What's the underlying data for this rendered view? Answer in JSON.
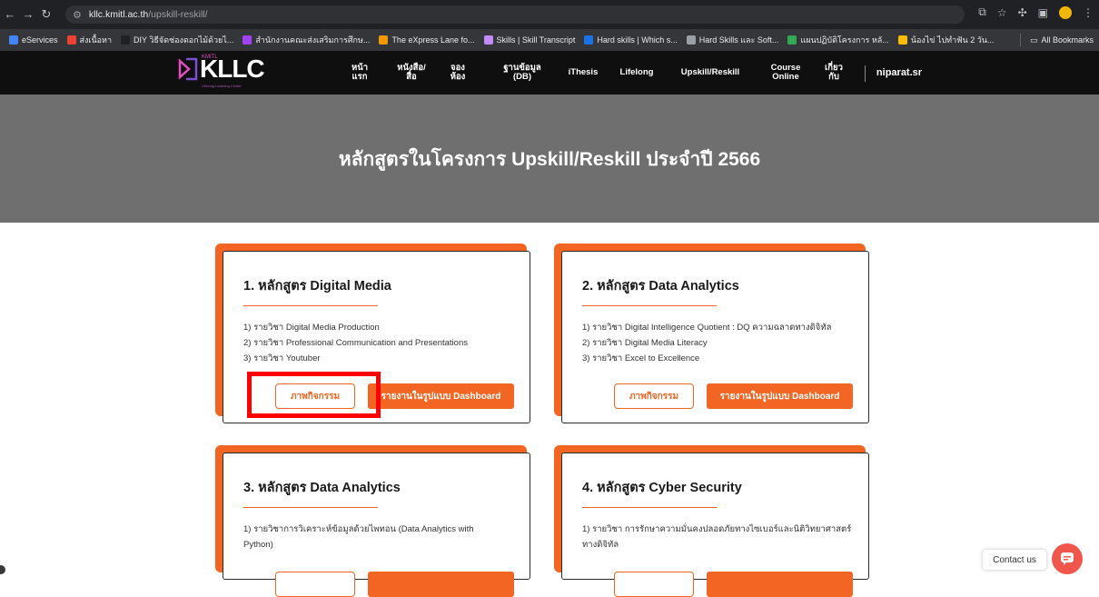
{
  "browser": {
    "url_host": "kllc.kmitl.ac.th",
    "url_path": "/upskill-reskill/",
    "bookmarks": [
      {
        "label": "eServices",
        "color": "#4285f4"
      },
      {
        "label": "ส่งเนื้อหา",
        "color": "#ea4335"
      },
      {
        "label": "DIY วิธีจัดช่องดอกไม้ด้วยไ...",
        "color": "#202124"
      },
      {
        "label": "สำนักงานคณะส่งเสริมการศึกษ...",
        "color": "#a142f4"
      },
      {
        "label": "The eXpress Lane fo...",
        "color": "#f29900"
      },
      {
        "label": "Skills | Skill Transcript",
        "color": "#c58af9"
      },
      {
        "label": "Hard skills | Which s...",
        "color": "#1a73e8"
      },
      {
        "label": "Hard Skills และ Soft...",
        "color": "#9aa0a6"
      },
      {
        "label": "แผนปฏิบัติโครงการ หลั...",
        "color": "#34a853"
      },
      {
        "label": "น้องไข่ ไปทำฟัน 2 วัน...",
        "color": "#fbbc04"
      }
    ],
    "all_bookmarks_label": "All Bookmarks"
  },
  "site": {
    "logo_text": "KLLC",
    "logo_kmitl": "KMITL",
    "logo_sub": "Lifelong Learning Center",
    "menu": [
      {
        "label": "หน้า\nแรก"
      },
      {
        "label": "หนังสือ/\nสื่อ"
      },
      {
        "label": "จอง\nห้อง"
      },
      {
        "label": "ฐานข้อมูล\n(DB)"
      },
      {
        "label": "iThesis"
      },
      {
        "label": "Lifelong"
      },
      {
        "label": "Upskill/Reskill"
      },
      {
        "label": "Course\nOnline"
      },
      {
        "label": "เกี่ยว\nกับ"
      }
    ],
    "username": "niparat.sr"
  },
  "hero": {
    "title": "หลักสูตรในโครงการ Upskill/Reskill ประจำปี 2566"
  },
  "cards": [
    {
      "title": "1. หลักสูตร Digital Media",
      "lines": [
        "1) รายวิชา Digital Media Production",
        "2) รายวิชา Professional Communication and Presentations",
        "3) รายวิชา Youtuber"
      ],
      "btn_activity": "ภาพกิจกรรม",
      "btn_dashboard": "รายงานในรูปแบบ Dashboard"
    },
    {
      "title": "2. หลักสูตร Data Analytics",
      "lines": [
        "1) รายวิชา Digital Intelligence Quotient : DQ ความฉลาดทางดิจิทัล",
        "2) รายวิชา Digital Media Literacy",
        "3) รายวิชา Excel to Excellence"
      ],
      "btn_activity": "ภาพกิจกรรม",
      "btn_dashboard": "รายงานในรูปแบบ Dashboard"
    },
    {
      "title": "3. หลักสูตร Data Analytics",
      "lines": [
        "1) รายวิชาการวิเคราะห์ข้อมูลด้วยไพทอน (Data Analytics with",
        "Python)"
      ],
      "btn_activity": "",
      "btn_dashboard": ""
    },
    {
      "title": "4. หลักสูตร Cyber Security",
      "lines": [
        "1) รายวิชา การรักษาความมั่นคงปลอดภัยทางไซเบอร์และนิติวิทยาศาสตร์",
        "ทางดิจิทัล"
      ],
      "btn_activity": "",
      "btn_dashboard": ""
    }
  ],
  "contact": {
    "label": "Contact us"
  },
  "colors": {
    "accent": "#f26522",
    "highlight": "#ff0000",
    "hero_bg": "#6f6f6f",
    "nav_bg": "#0f0f0f"
  }
}
